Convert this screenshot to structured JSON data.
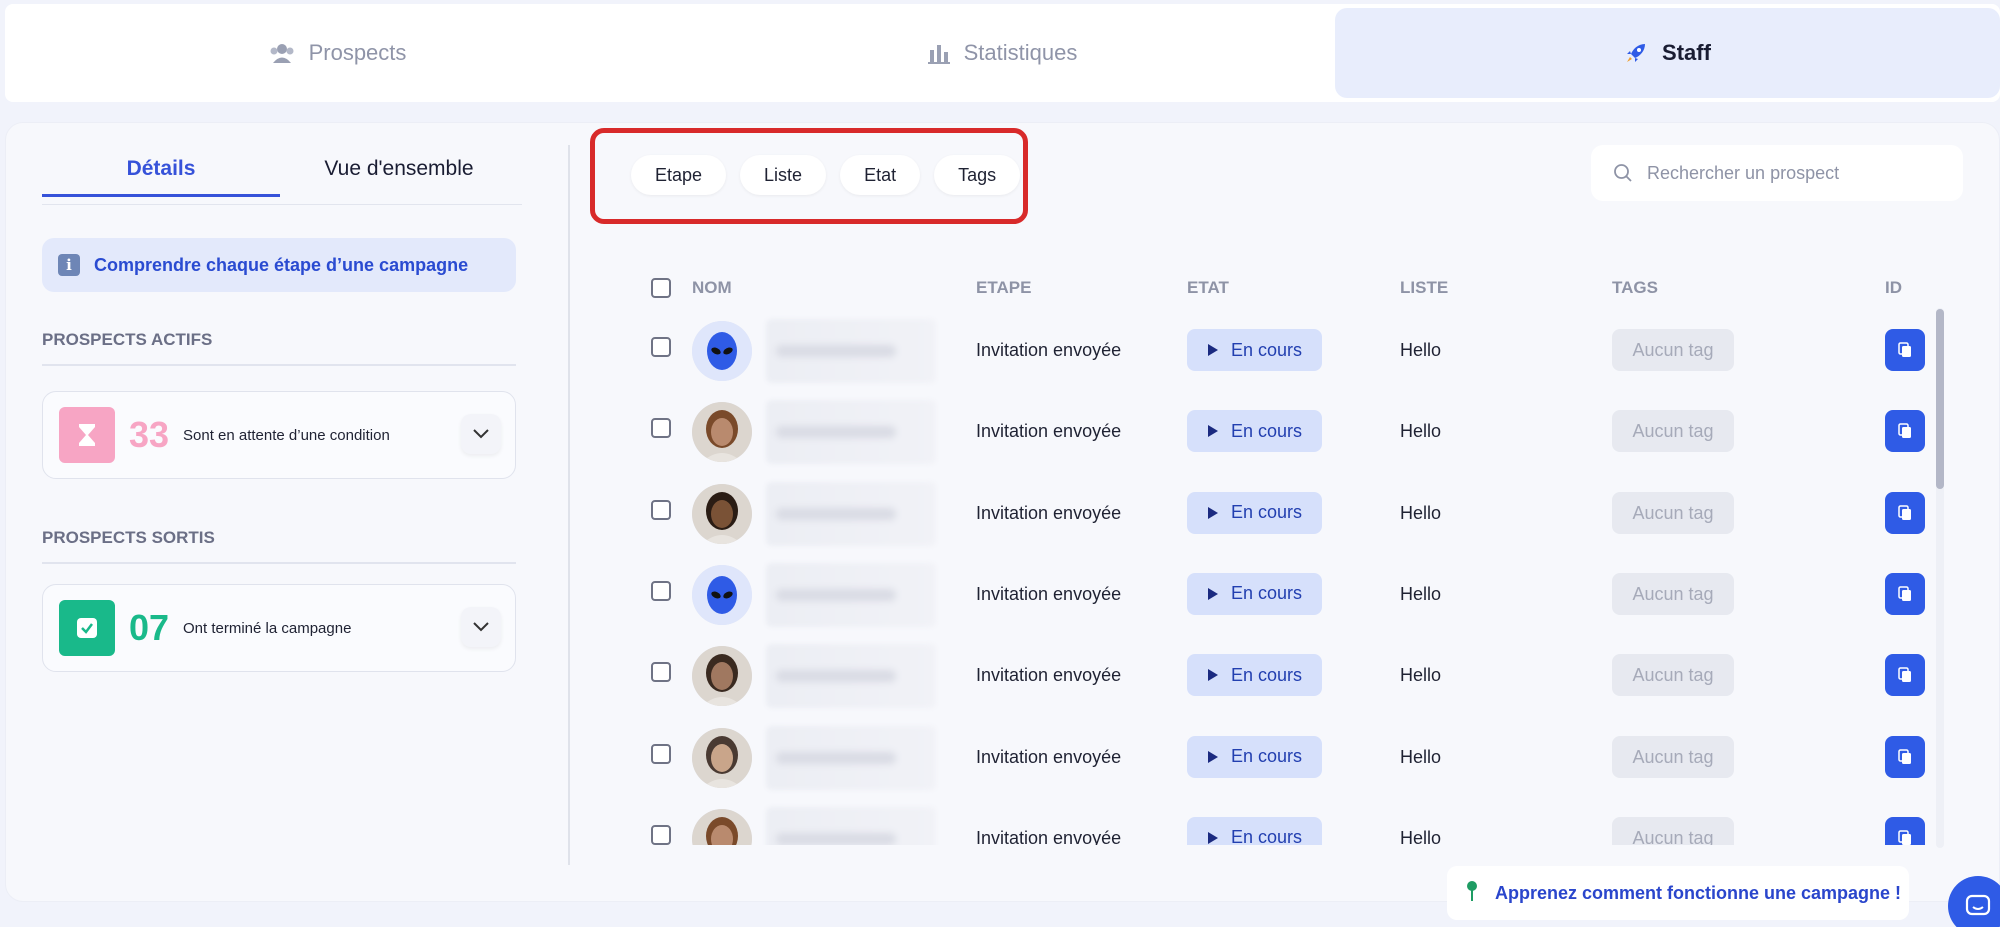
{
  "tabs": [
    {
      "label": "Prospects",
      "icon": "users-icon",
      "active": false
    },
    {
      "label": "Statistiques",
      "icon": "bar-chart-icon",
      "active": false
    },
    {
      "label": "Staff",
      "icon": "rocket-icon",
      "active": true
    }
  ],
  "left": {
    "subtabs": [
      {
        "label": "Détails",
        "active": true
      },
      {
        "label": "Vue d'ensemble",
        "active": false
      }
    ],
    "info_label": "Comprendre chaque étape d’une campagne",
    "active_title": "PROSPECTS ACTIFS",
    "active_card": {
      "count": "33",
      "text": "Sont en attente d’une condition",
      "color": "#f7a5c4"
    },
    "exited_title": "PROSPECTS SORTIS",
    "exited_card": {
      "count": "07",
      "text": "Ont terminé la campagne",
      "color": "#19b98a"
    }
  },
  "filters": [
    "Etape",
    "Liste",
    "Etat",
    "Tags"
  ],
  "search": {
    "placeholder": "Rechercher un prospect"
  },
  "table": {
    "headers": {
      "name": "NOM",
      "step": "ETAPE",
      "state": "ETAT",
      "list": "LISTE",
      "tags": "TAGS",
      "id": "ID"
    },
    "rows": [
      {
        "avatar": "alien",
        "step": "Invitation envoyée",
        "state": "En cours",
        "list": "Hello",
        "tag": "Aucun tag"
      },
      {
        "avatar": "photo",
        "step": "Invitation envoyée",
        "state": "En cours",
        "list": "Hello",
        "tag": "Aucun tag"
      },
      {
        "avatar": "photo",
        "step": "Invitation envoyée",
        "state": "En cours",
        "list": "Hello",
        "tag": "Aucun tag"
      },
      {
        "avatar": "alien",
        "step": "Invitation envoyée",
        "state": "En cours",
        "list": "Hello",
        "tag": "Aucun tag"
      },
      {
        "avatar": "photo",
        "step": "Invitation envoyée",
        "state": "En cours",
        "list": "Hello",
        "tag": "Aucun tag"
      },
      {
        "avatar": "photo",
        "step": "Invitation envoyée",
        "state": "En cours",
        "list": "Hello",
        "tag": "Aucun tag"
      },
      {
        "avatar": "photo",
        "step": "Invitation envoyée",
        "state": "En cours",
        "list": "Hello",
        "tag": "Aucun tag"
      }
    ]
  },
  "help": {
    "label": "Apprenez comment fonctionne une campagne !"
  },
  "colors": {
    "accent": "#2f5be6",
    "status_bg": "#d6e0fb",
    "highlight": "#d82a2a"
  }
}
